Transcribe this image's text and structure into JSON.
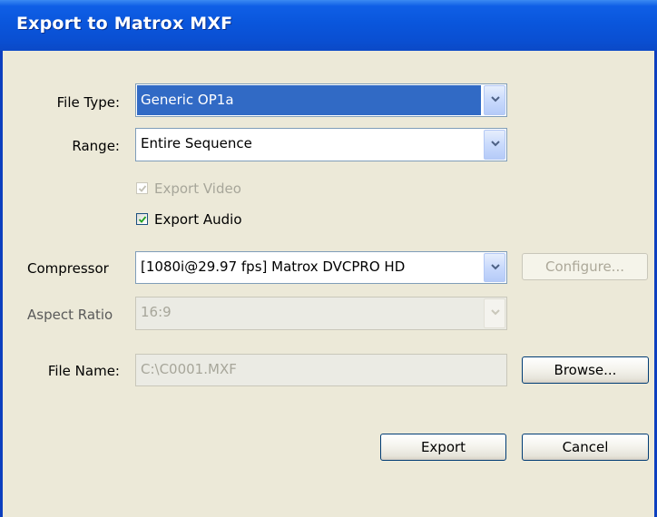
{
  "window": {
    "title": "Export to Matrox MXF"
  },
  "form": {
    "file_type": {
      "label": "File Type:",
      "value": "Generic OP1a"
    },
    "range": {
      "label": "Range:",
      "value": "Entire Sequence"
    },
    "export_video": {
      "label": "Export Video",
      "checked": true,
      "enabled": false
    },
    "export_audio": {
      "label": "Export Audio",
      "checked": true,
      "enabled": true
    },
    "compressor": {
      "label": "Compressor",
      "value": "[1080i@29.97 fps] Matrox DVCPRO HD"
    },
    "configure_label": "Configure...",
    "aspect_ratio": {
      "label": "Aspect Ratio",
      "value": "16:9"
    },
    "file_name": {
      "label": "File Name:",
      "value": "C:\\C0001.MXF"
    },
    "browse_label": "Browse..."
  },
  "buttons": {
    "export_label": "Export",
    "cancel_label": "Cancel"
  },
  "colors": {
    "titlebar": "#0a56dc",
    "dialog_bg": "#ece9d8",
    "selection": "#316ac5",
    "checkmark": "#21a121"
  },
  "icons": {
    "dropdown": "chevron-down-icon",
    "check": "checkmark-icon"
  }
}
